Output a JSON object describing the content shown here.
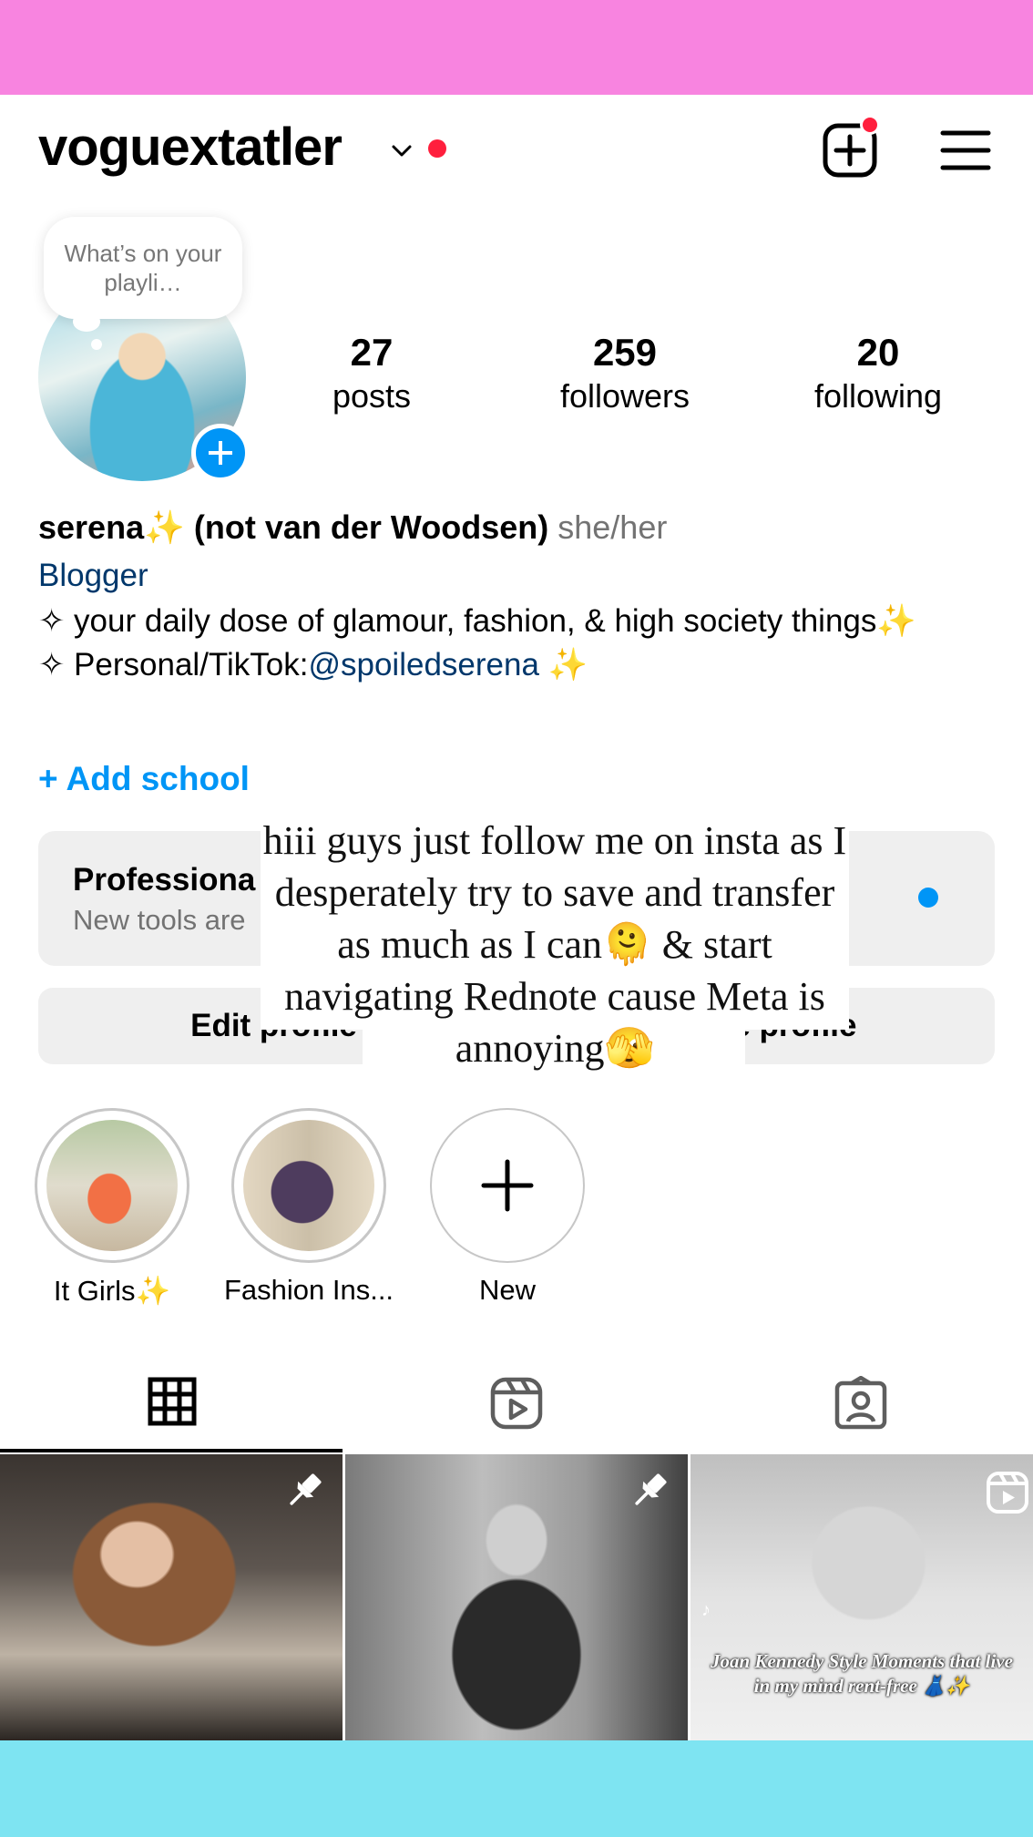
{
  "profile": {
    "username": "voguextatler",
    "note": "What’s on your playli…"
  },
  "stats": {
    "posts_count": "27",
    "posts_label": "posts",
    "followers_count": "259",
    "followers_label": "followers",
    "following_count": "20",
    "following_label": "following"
  },
  "bio": {
    "name": "serena✨ (not van der Woodsen)",
    "pronouns": "she/her",
    "category": "Blogger",
    "line1": "✧ your daily dose of glamour, fashion, & high society things✨",
    "line2_prefix": "✧ Personal/TikTok:",
    "line2_link": "@spoiledserena",
    "line2_suffix": " ✨",
    "add_school": "+ Add school"
  },
  "professional_dashboard": {
    "title": "Professiona",
    "subtitle": "New tools are"
  },
  "buttons": {
    "edit": "Edit profile",
    "share": "Share profile"
  },
  "overlay_caption": "hiii guys just follow me on insta as I desperately try to save and transfer as much as I can🫠 & start navigating Rednote cause Meta is annoying🫣",
  "highlights": [
    {
      "label": "It Girls✨"
    },
    {
      "label": "Fashion Ins..."
    },
    {
      "label": "New"
    }
  ],
  "posts": [
    {
      "pinned": true
    },
    {
      "pinned": true
    },
    {
      "caption": "Joan Kennedy Style Moments that live in my mind rent-free 👗✨",
      "reel": true
    }
  ],
  "colors": {
    "top_band": "#f884e0",
    "bottom_band": "#7ee4f2",
    "accent_blue": "#0095f6",
    "link_blue": "#00376b",
    "notification_red": "#ff1f3d"
  },
  "icons": {
    "header": [
      "chevron-down-icon",
      "add-post-icon",
      "menu-icon"
    ],
    "tabs": [
      "grid-icon",
      "reels-icon",
      "tagged-icon"
    ]
  }
}
